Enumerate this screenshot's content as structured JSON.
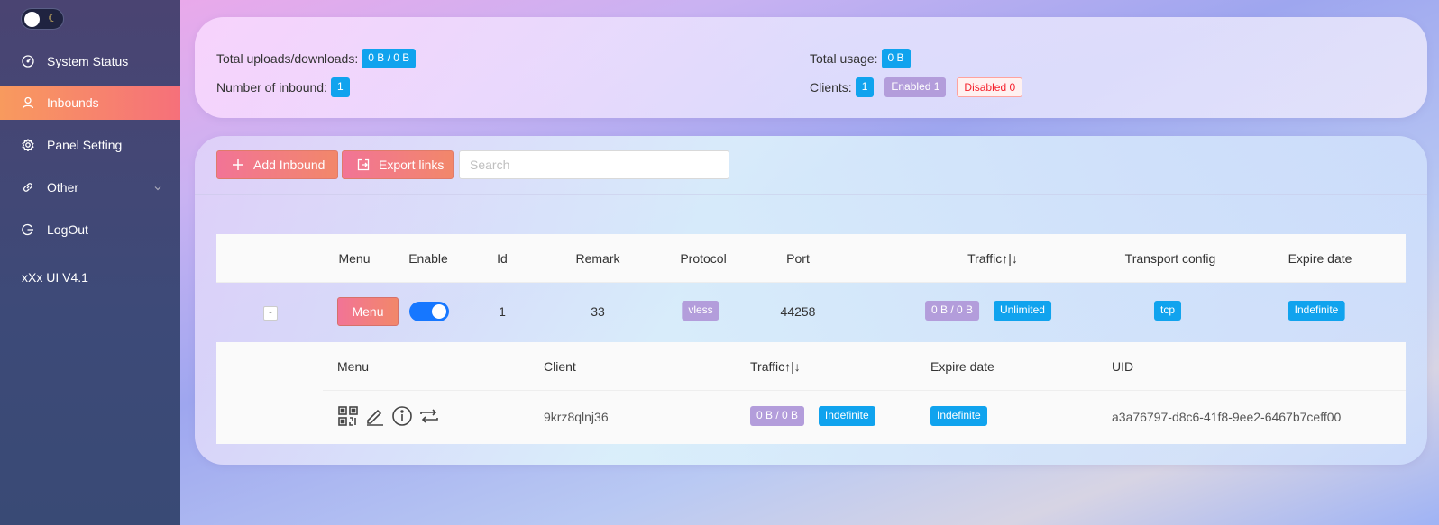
{
  "sidebar": {
    "items": [
      {
        "label": "System Status",
        "icon": "dashboard-icon"
      },
      {
        "label": "Inbounds",
        "icon": "user-icon",
        "active": true
      },
      {
        "label": "Panel Setting",
        "icon": "gear-icon"
      },
      {
        "label": "Other",
        "icon": "link-icon"
      },
      {
        "label": "LogOut",
        "icon": "logout-icon"
      }
    ],
    "version": "xXx UI V4.1"
  },
  "stats": {
    "total_updown_label": "Total uploads/downloads:",
    "total_updown_value": "0 B / 0 B",
    "inbound_count_label": "Number of inbound:",
    "inbound_count_value": "1",
    "total_usage_label": "Total usage:",
    "total_usage_value": "0 B",
    "clients_label": "Clients:",
    "clients_value": "1",
    "enabled": "Enabled 1",
    "disabled": "Disabled 0"
  },
  "toolbar": {
    "add_label": "Add Inbound",
    "export_label": "Export links",
    "search_placeholder": "Search"
  },
  "table": {
    "headers": [
      "Menu",
      "Enable",
      "Id",
      "Remark",
      "Protocol",
      "Port",
      "Traffic↑|↓",
      "Transport config",
      "Expire date"
    ],
    "row": {
      "expand": "-",
      "menu": "Menu",
      "enabled": true,
      "id": "1",
      "remark": "33",
      "protocol": "vless",
      "port": "44258",
      "traffic": "0 B / 0 B",
      "limit": "Unlimited",
      "transport": "tcp",
      "expire": "Indefinite"
    }
  },
  "clients": {
    "headers": [
      "Menu",
      "Client",
      "Traffic↑|↓",
      "Expire date",
      "UID"
    ],
    "row": {
      "client": "9krz8qlnj36",
      "traffic": "0 B / 0 B",
      "traffic_limit": "Indefinite",
      "expire": "Indefinite",
      "uid": "a3a76797-d8c6-41f8-9ee2-6467b7ceff00"
    }
  },
  "colors": {
    "accent_blue": "#10a3ee",
    "tag_purple": "#b39ddb",
    "gradient_start": "#f27496",
    "gradient_end": "#f2876a",
    "switch_on": "#1677ff"
  }
}
